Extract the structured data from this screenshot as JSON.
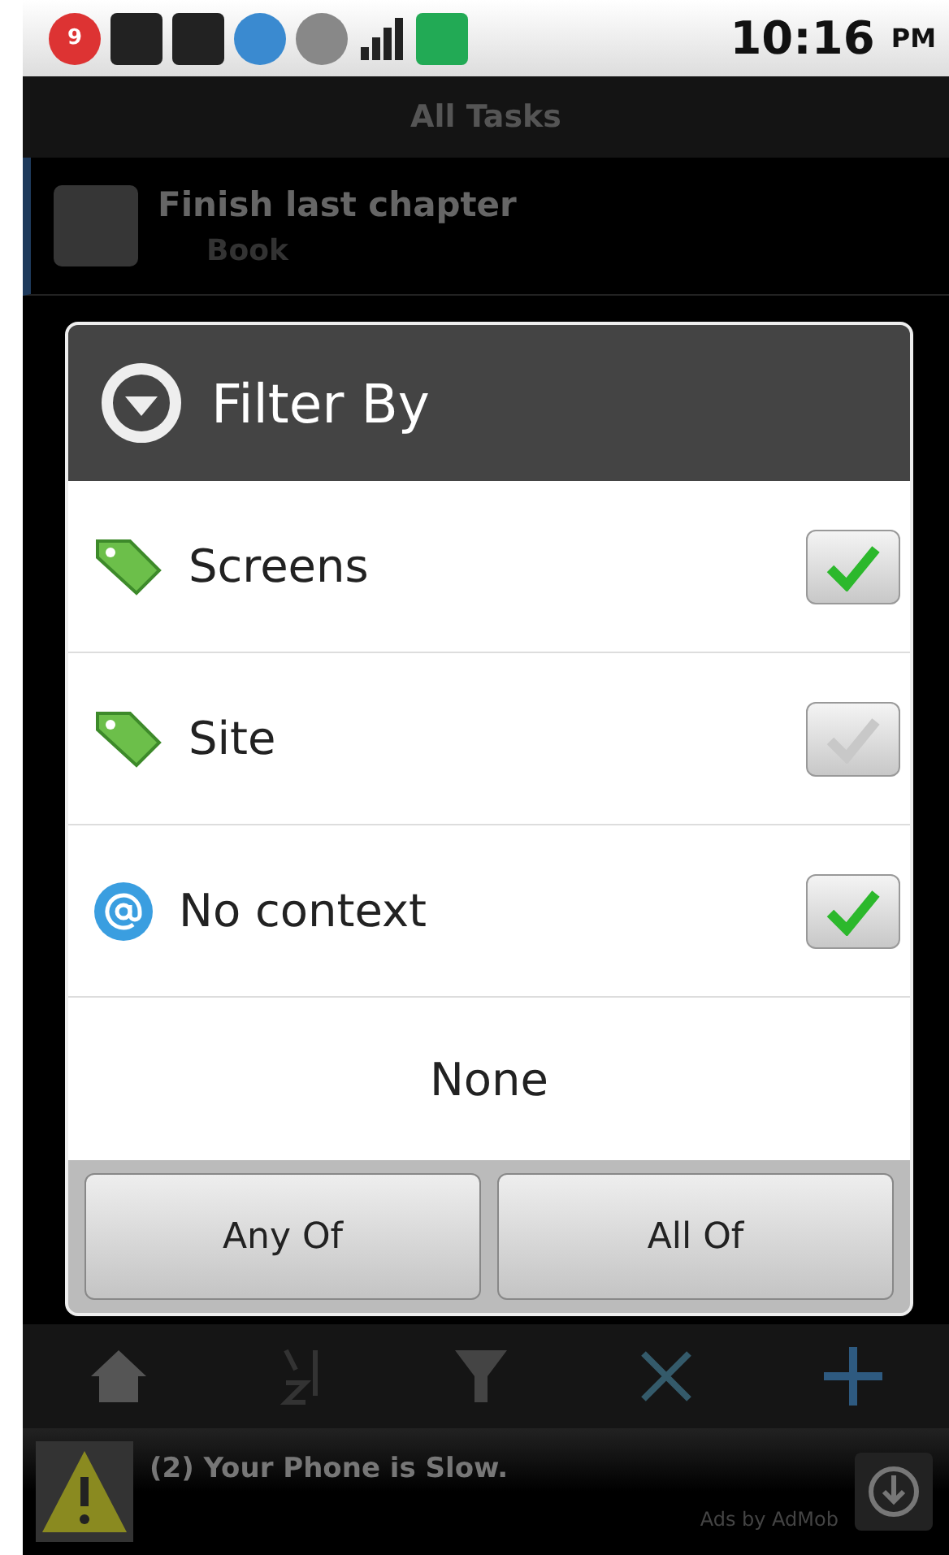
{
  "status_bar": {
    "notification_count": "9",
    "time": "10:16",
    "meridiem": "PM"
  },
  "title": "All Tasks",
  "tasks": [
    {
      "title": "Finish last chapter",
      "context": "Book",
      "done": false
    }
  ],
  "dialog": {
    "title": "Filter By",
    "options": [
      {
        "kind": "tag",
        "label": "Screens",
        "checked": true
      },
      {
        "kind": "tag",
        "label": "Site",
        "checked": false
      },
      {
        "kind": "at",
        "label": "No context",
        "checked": true
      }
    ],
    "none_label": "None",
    "buttons": [
      "Any Of",
      "All Of"
    ]
  },
  "ad": {
    "text": "(2) Your Phone is Slow.",
    "credit": "Ads by AdMob"
  }
}
